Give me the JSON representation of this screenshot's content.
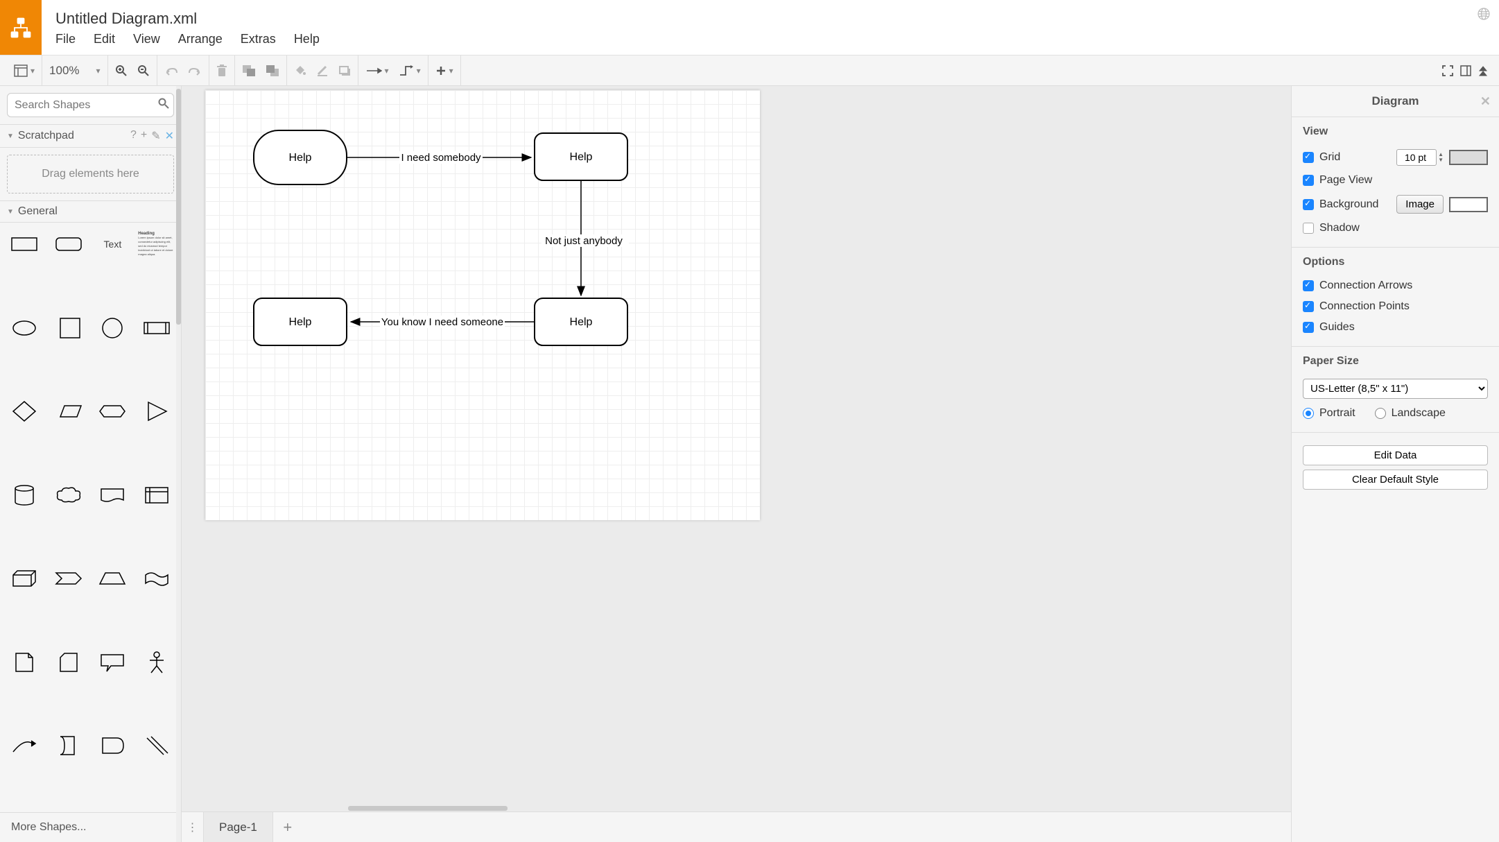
{
  "title": "Untitled Diagram.xml",
  "menu": {
    "file": "File",
    "edit": "Edit",
    "view": "View",
    "arrange": "Arrange",
    "extras": "Extras",
    "help": "Help"
  },
  "toolbar": {
    "zoom": "100%"
  },
  "sidebar": {
    "search_placeholder": "Search Shapes",
    "scratchpad": "Scratchpad",
    "dropzone": "Drag elements here",
    "general": "General",
    "text": "Text",
    "heading": "Heading",
    "lorem": "Lorem ipsum dolor sit amet, consectetur adipiscing elit, sed do eiusmod tempor incididunt ut labore et dolore magna aliqua.",
    "more_shapes": "More Shapes..."
  },
  "canvas": {
    "nodes": [
      {
        "id": "n1",
        "label": "Help"
      },
      {
        "id": "n2",
        "label": "Help"
      },
      {
        "id": "n3",
        "label": "Help"
      },
      {
        "id": "n4",
        "label": "Help"
      }
    ],
    "edges": [
      {
        "label": "I need somebody"
      },
      {
        "label": "Not just anybody"
      },
      {
        "label": "You know I need someone"
      }
    ]
  },
  "tabs": {
    "page1": "Page-1"
  },
  "panel": {
    "title": "Diagram",
    "view": "View",
    "grid": "Grid",
    "grid_pt": "10 pt",
    "page_view": "Page View",
    "background": "Background",
    "image": "Image",
    "shadow": "Shadow",
    "options": "Options",
    "conn_arrows": "Connection Arrows",
    "conn_points": "Connection Points",
    "guides": "Guides",
    "paper_size": "Paper Size",
    "paper_value": "US-Letter (8,5\" x 11\")",
    "portrait": "Portrait",
    "landscape": "Landscape",
    "edit_data": "Edit Data",
    "clear_style": "Clear Default Style"
  }
}
